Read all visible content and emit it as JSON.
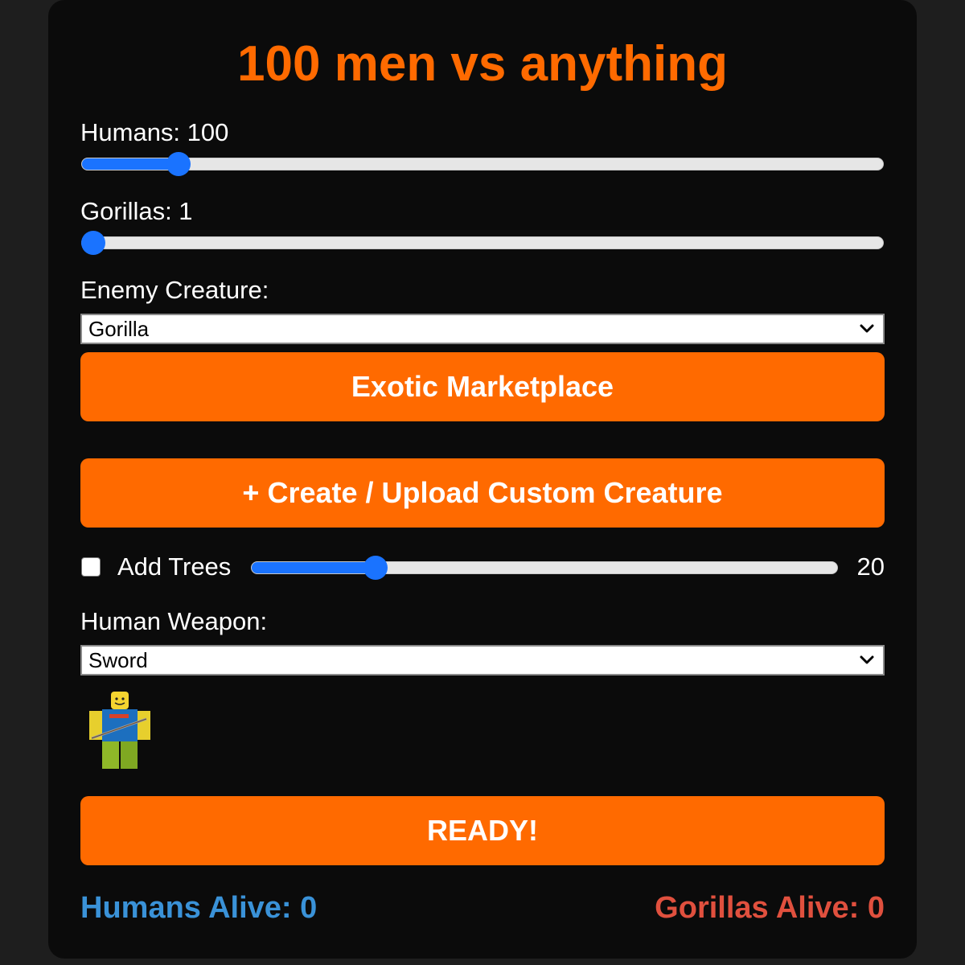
{
  "title": "100 men vs anything",
  "humans": {
    "label": "Humans: 100",
    "value": 100,
    "fraction": 0.11
  },
  "gorillas": {
    "label": "Gorillas: 1",
    "value": 1,
    "fraction": 0.0
  },
  "enemy_creature": {
    "label": "Enemy Creature:",
    "selected": "Gorilla"
  },
  "buttons": {
    "marketplace": "Exotic Marketplace",
    "custom_creature": "+ Create / Upload Custom Creature",
    "ready": "READY!"
  },
  "trees": {
    "label": "Add Trees",
    "checked": false,
    "value": "20",
    "fraction": 0.2
  },
  "human_weapon": {
    "label": "Human Weapon:",
    "selected": "Sword"
  },
  "status": {
    "humans_alive": "Humans Alive: 0",
    "gorillas_alive": "Gorillas Alive: 0"
  },
  "colors": {
    "accent": "#ff6a00",
    "slider": "#1a73ff",
    "humans_status": "#3a92d8",
    "gorillas_status": "#e0503e",
    "panel": "#0b0b0b",
    "background": "#1e1e1e"
  },
  "icons": {
    "select_chevron": "chevron-down-icon",
    "weapon_preview": "roblox-noob-sword-avatar"
  }
}
